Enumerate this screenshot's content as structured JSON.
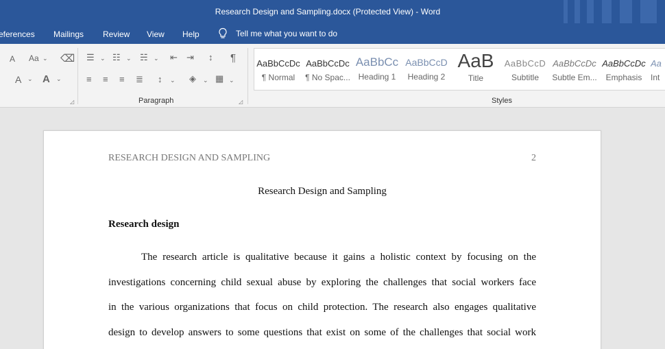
{
  "window": {
    "title": "Research Design and Sampling.docx (Protected View)  -  Word"
  },
  "tabs": [
    "eferences",
    "Mailings",
    "Review",
    "View",
    "Help"
  ],
  "tell_me": "Tell me what you want to do",
  "ribbon": {
    "font_group": {
      "font_size_down_icon": "A",
      "change_case_label": "Aa",
      "clear_format_icon": "eraser-icon",
      "font_color_label": "A",
      "text_effects_label": "A"
    },
    "paragraph_group": {
      "label": "Paragraph",
      "show_marks_glyph": "¶"
    },
    "styles_group": {
      "label": "Styles",
      "items": [
        {
          "sample": "AaBbCcDc",
          "name": "¶ Normal"
        },
        {
          "sample": "AaBbCcDc",
          "name": "¶ No Spac..."
        },
        {
          "sample": "AaBbCc",
          "name": "Heading 1"
        },
        {
          "sample": "AaBbCcD",
          "name": "Heading 2"
        },
        {
          "sample": "AaB",
          "name": "Title"
        },
        {
          "sample": "AaBbCcD",
          "name": "Subtitle"
        },
        {
          "sample": "AaBbCcDc",
          "name": "Subtle Em..."
        },
        {
          "sample": "AaBbCcDc",
          "name": "Emphasis"
        },
        {
          "sample": "Aa",
          "name": "Int"
        }
      ]
    }
  },
  "document": {
    "running_head": "RESEARCH DESIGN AND SAMPLING",
    "page_number": "2",
    "title": "Research Design and Sampling",
    "heading": "Research design",
    "lines": [
      "The research article is qualitative because it gains a holistic context by focusing on the",
      "investigations concerning child sexual abuse by exploring the challenges that social workers face",
      "in the various organizations that focus on child protection. The research also engages qualitative",
      "design to develop answers to some questions that exist on some of the challenges that social work"
    ]
  },
  "colors": {
    "word_blue": "#2b579a",
    "ribbon_bg": "#f3f3f3",
    "doc_bg": "#e6e6e6"
  }
}
